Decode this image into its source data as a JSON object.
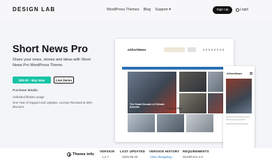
{
  "header": {
    "logo": "DESIGN LAB",
    "nav": [
      "WordPress Themes",
      "Blog",
      "Support ▾"
    ],
    "signup_label": "Sign Up",
    "login_label": "Login"
  },
  "hero": {
    "title": "Short News Pro",
    "description": "Share your news, stories and ideas with Short News Pro WordPress Theme.",
    "buy_label": "$30.00 – Buy Now",
    "demo_label": "Live Demo",
    "purchase_title": "Purchase details:",
    "purchase_items": [
      "Unlimited lifetime usage",
      "One Year of Support and Updates. License Renewal at 30% discount"
    ]
  },
  "preview": {
    "logo": "eShortNews",
    "headline": "The Smart Decade of Climate Scientis",
    "editors_pick": "Editor's Pick",
    "mobile_logo": "eShortNews"
  },
  "info": {
    "theme_info_label": "Theme info",
    "version_label": "VERSION",
    "version_value": "1.2.7",
    "last_updated_label": "LAST UPDATED",
    "last_updated_value": "2025-08-25",
    "history_label": "VERSION HISTORY",
    "history_value": "View changelog ›",
    "requirements_label": "REQUIREMENTS",
    "requirements_value": "WordPress 4.5"
  },
  "colors": {
    "accent": "#19c4a6",
    "dark": "#111111",
    "link": "#2a74c9",
    "hero_bg": "#f4f5f8"
  }
}
